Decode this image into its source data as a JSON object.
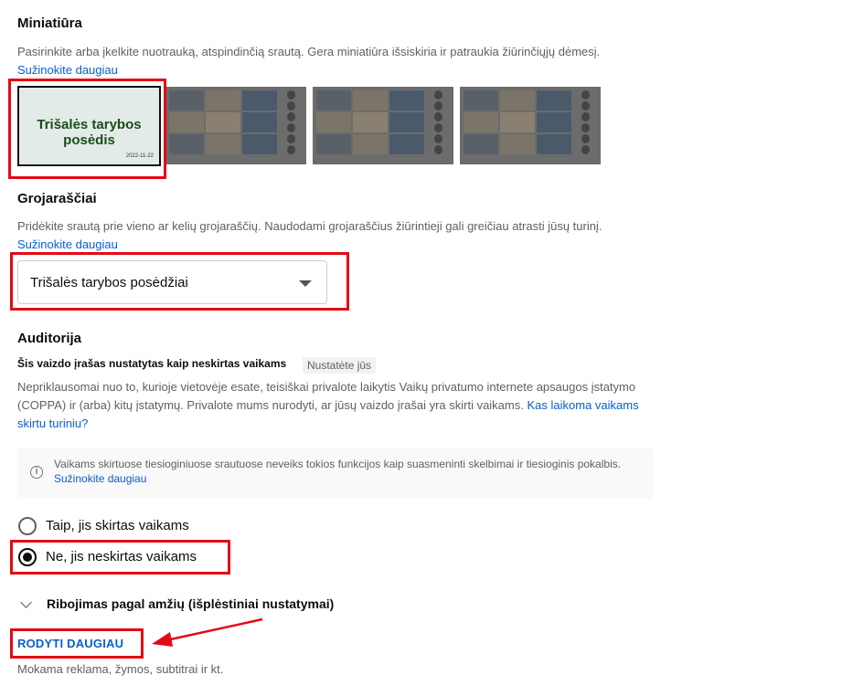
{
  "thumbnail": {
    "heading": "Miniatiūra",
    "description": "Pasirinkite arba įkelkite nuotrauką, atspindinčią srautą. Gera miniatiūra išsiskiria ir patraukia žiūrinčiųjų dėmesį.",
    "learn_more": "Sužinokite daugiau",
    "selected_title": "Trišalės tarybos posėdis",
    "selected_date": "2022-11-22"
  },
  "playlists": {
    "heading": "Grojaraščiai",
    "description": "Pridėkite srautą prie vieno ar kelių grojaraščių. Naudodami grojaraščius žiūrintieji gali greičiau atrasti jūsų turinį.",
    "learn_more": "Sužinokite daugiau",
    "selected": "Trišalės tarybos posėdžiai"
  },
  "audience": {
    "heading": "Auditorija",
    "status": "Šis vaizdo įrašas nustatytas kaip neskirtas vaikams",
    "badge": "Nustatėte jūs",
    "description": "Nepriklausomai nuo to, kurioje vietovėje esate, teisiškai privalote laikytis Vaikų privatumo internete apsaugos įstatymo (COPPA) ir (arba) kitų įstatymų. Privalote mums nurodyti, ar jūsų vaizdo įrašai yra skirti vaikams.",
    "desc_link": "Kas laikoma vaikams skirtu turiniu?",
    "info_text": "Vaikams skirtuose tiesioginiuose srautuose neveiks tokios funkcijos kaip suasmeninti skelbimai ir tiesioginis pokalbis.",
    "info_link": "Sužinokite daugiau",
    "option_yes": "Taip, jis skirtas vaikams",
    "option_no": "Ne, jis neskirtas vaikams",
    "selected_option": "no",
    "age_restriction": "Ribojimas pagal amžių (išplėstiniai nustatymai)"
  },
  "footer": {
    "show_more": "RODYTI DAUGIAU",
    "note": "Mokama reklama, žymos, subtitrai ir kt."
  },
  "colors": {
    "link": "#065fd4",
    "annotation": "#e50914"
  }
}
